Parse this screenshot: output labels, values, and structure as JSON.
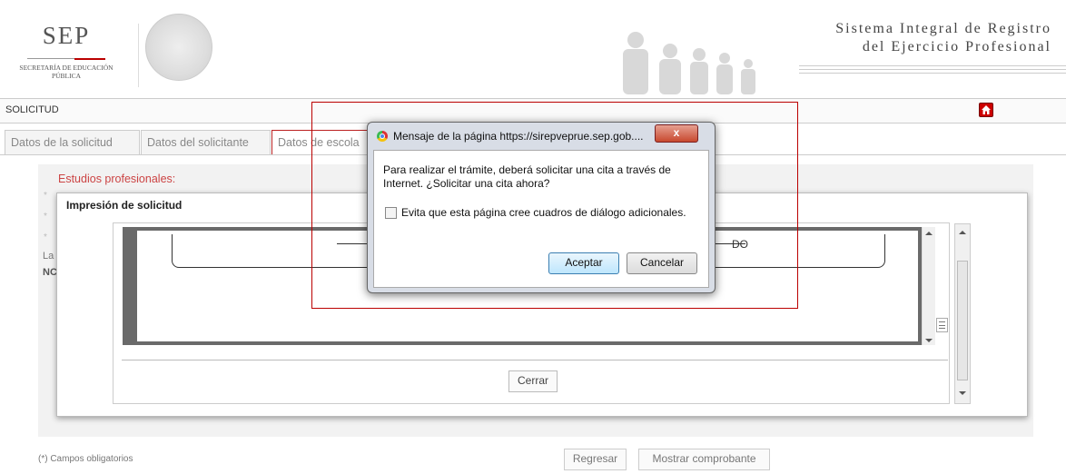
{
  "header": {
    "logo_title": "SEP",
    "logo_subtitle": "SECRETARÍA DE EDUCACIÓN PÚBLICA",
    "system_title_line1": "Sistema Integral de Registro",
    "system_title_line2": "del Ejercicio Profesional"
  },
  "section": {
    "label": "SOLICITUD"
  },
  "tabs": [
    {
      "label": "Datos de la solicitud"
    },
    {
      "label": "Datos del solicitante"
    },
    {
      "label": "Datos de escola"
    }
  ],
  "background_form": {
    "heading": "Estudios profesionales:",
    "stars": [
      "*",
      "*",
      "*"
    ],
    "frag_la": "La",
    "frag_nc": "NC"
  },
  "print_modal": {
    "title": "Impresión de solicitud",
    "doc_fragment": "DO",
    "close_label": "Cerrar"
  },
  "alert": {
    "title": "Mensaje de la página https://sirepveprue.sep.gob....",
    "close_symbol": "x",
    "message": "Para realizar el trámite, deberá solicitar una cita a través de Internet. ¿Solicitar una cita ahora?",
    "checkbox_label": "Evita que esta página cree cuadros de diálogo adicionales.",
    "ok_label": "Aceptar",
    "cancel_label": "Cancelar"
  },
  "footer": {
    "required_note": "(*) Campos obligatorios",
    "back_label": "Regresar",
    "show_receipt_label": "Mostrar comprobante"
  },
  "colors": {
    "highlight": "#b00000",
    "accent_red": "#cc0000"
  }
}
